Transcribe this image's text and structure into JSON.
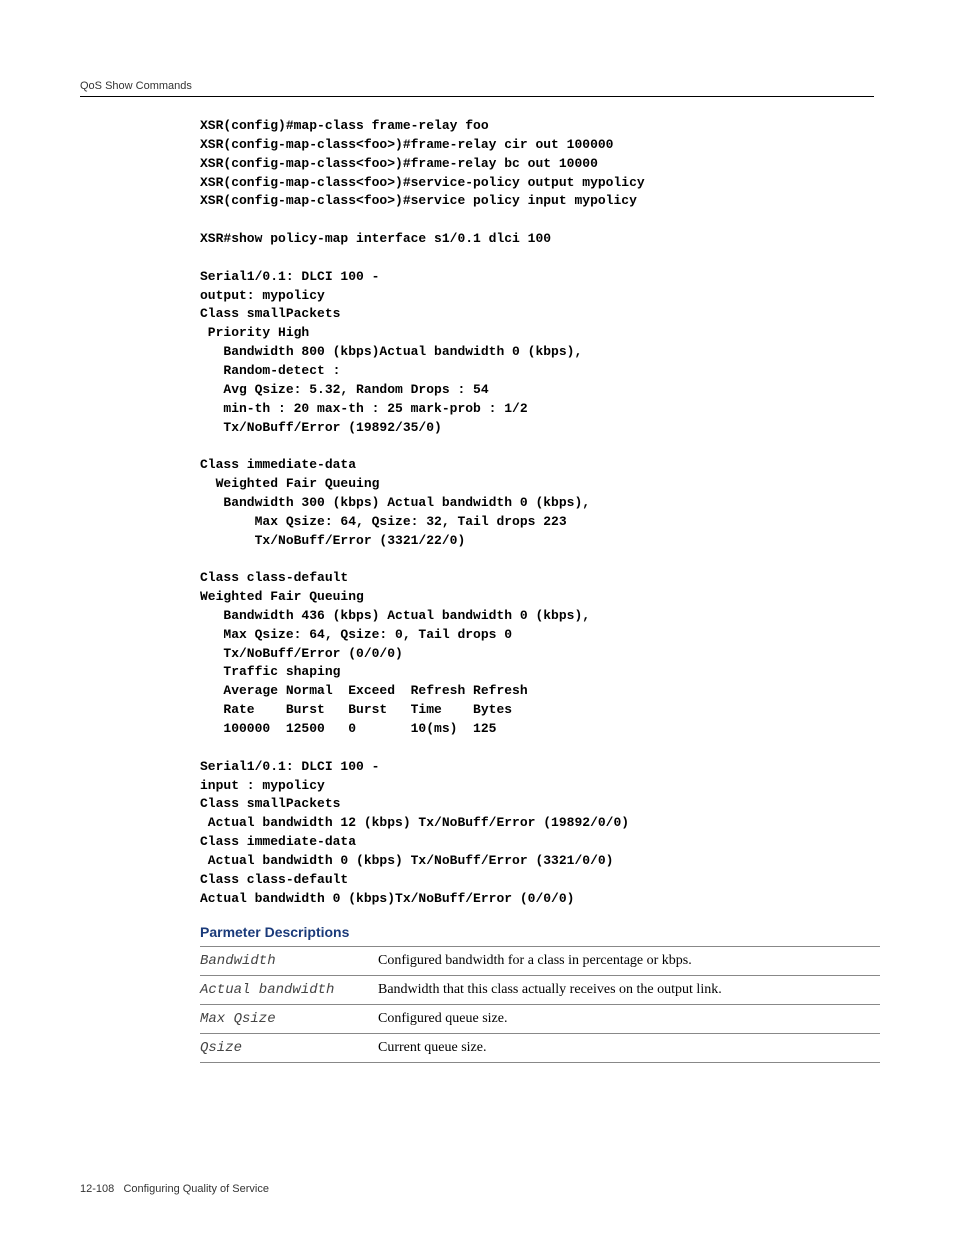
{
  "header": {
    "title": "QoS Show Commands"
  },
  "code": "XSR(config)#map-class frame-relay foo\nXSR(config-map-class<foo>)#frame-relay cir out 100000\nXSR(config-map-class<foo>)#frame-relay bc out 10000\nXSR(config-map-class<foo>)#service-policy output mypolicy\nXSR(config-map-class<foo>)#service policy input mypolicy\n\nXSR#show policy-map interface s1/0.1 dlci 100\n\nSerial1/0.1: DLCI 100 -\noutput: mypolicy\nClass smallPackets\n Priority High\n   Bandwidth 800 (kbps)Actual bandwidth 0 (kbps),\n   Random-detect :\n   Avg Qsize: 5.32, Random Drops : 54\n   min-th : 20 max-th : 25 mark-prob : 1/2\n   Tx/NoBuff/Error (19892/35/0)\n\nClass immediate-data\n  Weighted Fair Queuing\n   Bandwidth 300 (kbps) Actual bandwidth 0 (kbps),\n       Max Qsize: 64, Qsize: 32, Tail drops 223\n       Tx/NoBuff/Error (3321/22/0)\n\nClass class-default\nWeighted Fair Queuing\n   Bandwidth 436 (kbps) Actual bandwidth 0 (kbps),\n   Max Qsize: 64, Qsize: 0, Tail drops 0\n   Tx/NoBuff/Error (0/0/0)\n   Traffic shaping\n   Average Normal  Exceed  Refresh Refresh\n   Rate    Burst   Burst   Time    Bytes\n   100000  12500   0       10(ms)  125\n\nSerial1/0.1: DLCI 100 -\ninput : mypolicy\nClass smallPackets\n Actual bandwidth 12 (kbps) Tx/NoBuff/Error (19892/0/0)\nClass immediate-data\n Actual bandwidth 0 (kbps) Tx/NoBuff/Error (3321/0/0)\nClass class-default\nActual bandwidth 0 (kbps)Tx/NoBuff/Error (0/0/0)",
  "params": {
    "heading": "Parmeter Descriptions",
    "rows": [
      {
        "name": "Bandwidth",
        "desc": "Configured bandwidth for a class in percentage or kbps."
      },
      {
        "name": "Actual bandwidth",
        "desc": "Bandwidth that this class actually receives on the output link."
      },
      {
        "name": "Max Qsize",
        "desc": "Configured queue size."
      },
      {
        "name": "Qsize",
        "desc": "Current queue size."
      }
    ]
  },
  "footer": {
    "page": "12-108",
    "chapter": "Configuring Quality of Service"
  }
}
